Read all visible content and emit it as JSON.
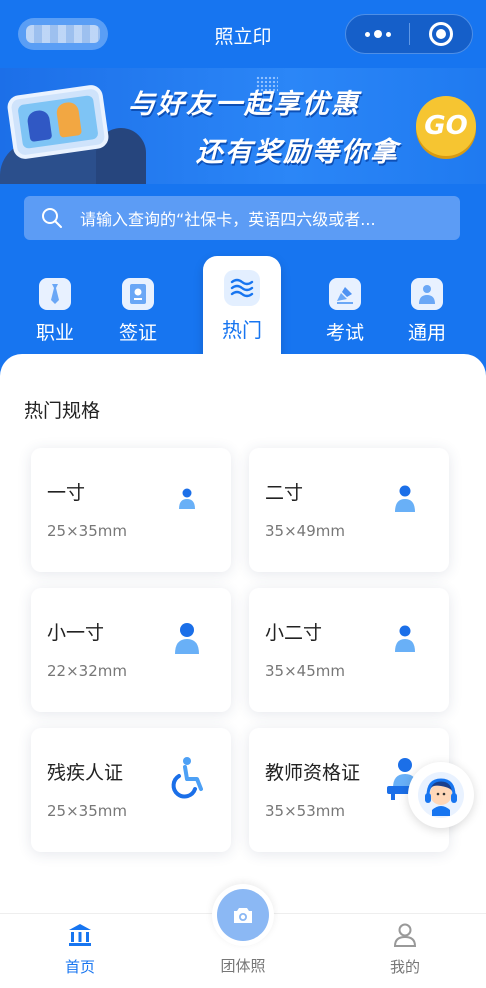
{
  "header": {
    "title": "照立印"
  },
  "banner": {
    "line1": "与好友一起享优惠",
    "line2": "还有奖励等你拿",
    "go_label": "GO"
  },
  "search": {
    "placeholder": "请输入查询的“社保卡，英语四六级或者..."
  },
  "categories": [
    {
      "label": "职业",
      "icon": "tie-icon"
    },
    {
      "label": "签证",
      "icon": "passport-icon"
    },
    {
      "label": "热门",
      "icon": "waves-icon",
      "active": true
    },
    {
      "label": "考试",
      "icon": "exam-icon"
    },
    {
      "label": "通用",
      "icon": "person-icon"
    }
  ],
  "section": {
    "title": "热门规格"
  },
  "specs": [
    {
      "name": "一寸",
      "size": "25×35mm",
      "icon": "person-icon"
    },
    {
      "name": "二寸",
      "size": "35×49mm",
      "icon": "person-icon"
    },
    {
      "name": "小一寸",
      "size": "22×32mm",
      "icon": "person-icon"
    },
    {
      "name": "小二寸",
      "size": "35×45mm",
      "icon": "person-icon"
    },
    {
      "name": "残疾人证",
      "size": "25×35mm",
      "icon": "wheelchair-icon"
    },
    {
      "name": "教师资格证",
      "size": "35×53mm",
      "icon": "teacher-icon"
    }
  ],
  "tabbar": {
    "home": "首页",
    "group": "团体照",
    "mine": "我的"
  },
  "colors": {
    "primary": "#1775f0",
    "card_bg": "#ffffff",
    "go_yellow": "#f6c531"
  }
}
